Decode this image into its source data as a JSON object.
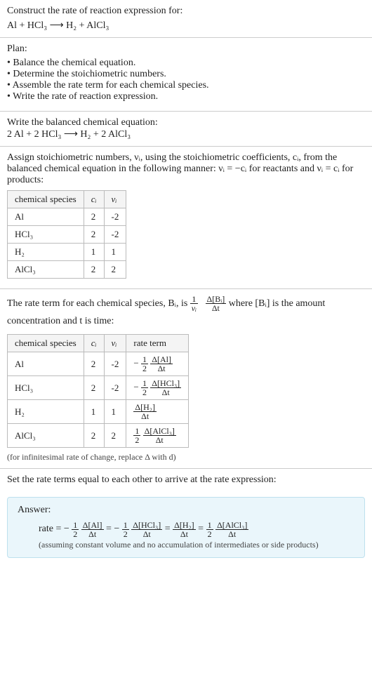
{
  "header": {
    "prompt": "Construct the rate of reaction expression for:",
    "equation": "Al + HCl₃  ⟶  H₂ + AlCl₃"
  },
  "plan": {
    "title": "Plan:",
    "items": [
      "Balance the chemical equation.",
      "Determine the stoichiometric numbers.",
      "Assemble the rate term for each chemical species.",
      "Write the rate of reaction expression."
    ]
  },
  "balanced": {
    "title": "Write the balanced chemical equation:",
    "equation": "2 Al + 2 HCl₃  ⟶  H₂ + 2 AlCl₃"
  },
  "stoich": {
    "intro_a": "Assign stoichiometric numbers, νᵢ, using the stoichiometric coefficients, cᵢ, from the balanced chemical equation in the following manner: νᵢ = −cᵢ for reactants and νᵢ = cᵢ for products:",
    "headers": [
      "chemical species",
      "cᵢ",
      "νᵢ"
    ],
    "rows": [
      {
        "species": "Al",
        "c": "2",
        "nu": "-2"
      },
      {
        "species": "HCl₃",
        "c": "2",
        "nu": "-2"
      },
      {
        "species": "H₂",
        "c": "1",
        "nu": "1"
      },
      {
        "species": "AlCl₃",
        "c": "2",
        "nu": "2"
      }
    ]
  },
  "rateterm": {
    "intro_a": "The rate term for each chemical species, Bᵢ, is ",
    "intro_b": " where [Bᵢ] is the amount concentration and t is time:",
    "frac_outer_num": "1",
    "frac_outer_den": "νᵢ",
    "frac_inner_num": "Δ[Bᵢ]",
    "frac_inner_den": "Δt",
    "headers": [
      "chemical species",
      "cᵢ",
      "νᵢ",
      "rate term"
    ],
    "rows": [
      {
        "species": "Al",
        "c": "2",
        "nu": "-2",
        "coef_sign": "−",
        "coef_num": "1",
        "coef_den": "2",
        "d_num": "Δ[Al]",
        "d_den": "Δt"
      },
      {
        "species": "HCl₃",
        "c": "2",
        "nu": "-2",
        "coef_sign": "−",
        "coef_num": "1",
        "coef_den": "2",
        "d_num": "Δ[HCl₃]",
        "d_den": "Δt"
      },
      {
        "species": "H₂",
        "c": "1",
        "nu": "1",
        "coef_sign": "",
        "coef_num": "",
        "coef_den": "",
        "d_num": "Δ[H₂]",
        "d_den": "Δt"
      },
      {
        "species": "AlCl₃",
        "c": "2",
        "nu": "2",
        "coef_sign": "",
        "coef_num": "1",
        "coef_den": "2",
        "d_num": "Δ[AlCl₃]",
        "d_den": "Δt"
      }
    ],
    "caption": "(for infinitesimal rate of change, replace Δ with d)"
  },
  "setequal": {
    "text": "Set the rate terms equal to each other to arrive at the rate expression:"
  },
  "answer": {
    "label": "Answer:",
    "prefix": "rate = ",
    "terms": [
      {
        "sign": "−",
        "num": "1",
        "den": "2",
        "d_num": "Δ[Al]",
        "d_den": "Δt"
      },
      {
        "sign": "−",
        "num": "1",
        "den": "2",
        "d_num": "Δ[HCl₃]",
        "d_den": "Δt"
      },
      {
        "sign": "",
        "num": "",
        "den": "",
        "d_num": "Δ[H₂]",
        "d_den": "Δt"
      },
      {
        "sign": "",
        "num": "1",
        "den": "2",
        "d_num": "Δ[AlCl₃]",
        "d_den": "Δt"
      }
    ],
    "caption": "(assuming constant volume and no accumulation of intermediates or side products)"
  }
}
